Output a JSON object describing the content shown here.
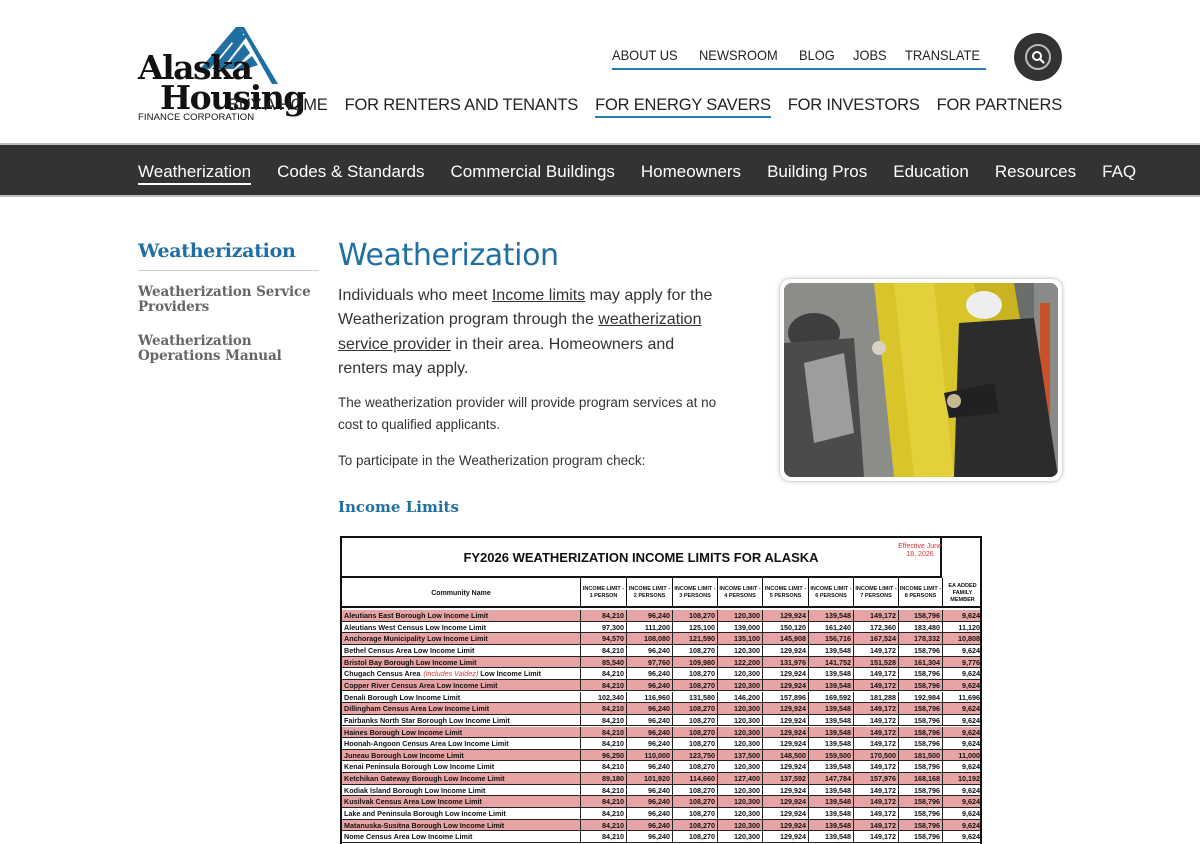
{
  "brand": {
    "line1": "Alaska",
    "line2": "Housing",
    "line3": "FINANCE CORPORATION",
    "colors": {
      "blue": "#1f6fa3",
      "nav_dark": "#333333"
    }
  },
  "utility_nav": [
    "ABOUT US",
    "NEWSROOM",
    "BLOG",
    "JOBS",
    "TRANSLATE"
  ],
  "search_icon": "search-icon",
  "main_nav": [
    {
      "label": "BUY A HOME",
      "active": false
    },
    {
      "label": "FOR RENTERS AND TENANTS",
      "active": false
    },
    {
      "label": "FOR ENERGY SAVERS",
      "active": true
    },
    {
      "label": "FOR INVESTORS",
      "active": false
    },
    {
      "label": "FOR PARTNERS",
      "active": false
    }
  ],
  "sub_nav": [
    {
      "label": "Weatherization",
      "active": true
    },
    {
      "label": "Codes & Standards",
      "active": false
    },
    {
      "label": "Commercial Buildings",
      "active": false
    },
    {
      "label": "Homeowners",
      "active": false
    },
    {
      "label": "Building Pros",
      "active": false
    },
    {
      "label": "Education",
      "active": false
    },
    {
      "label": "Resources",
      "active": false
    },
    {
      "label": "FAQ",
      "active": false
    }
  ],
  "sidebar": {
    "title": "Weatherization",
    "items": [
      {
        "line1": "Weatherization Service",
        "line2": "Providers"
      },
      {
        "line1": "Weatherization",
        "line2": "Operations Manual"
      }
    ]
  },
  "main": {
    "title": "Weatherization",
    "lead": {
      "t1": "Individuals who meet ",
      "link1": "Income limits",
      "t2": " may apply for the Weatherization program through the ",
      "link2": "weatherization service provider",
      "t3": " in their area. Homeowners and renters may apply."
    },
    "p2": "The weatherization provider will provide program services at no cost to qualified applicants.",
    "p3": "To participate in the Weatherization program check:",
    "section_heading": "Income Limits"
  },
  "income_table": {
    "title": "FY2026 WEATHERIZATION INCOME LIMITS FOR ALASKA",
    "effective": "Effective June 18, 2026",
    "headers": [
      "Community Name",
      "INCOME LIMIT - 1 PERSON",
      "INCOME LIMIT - 2 PERSONS",
      "INCOME LIMIT - 3 PERSONS",
      "INCOME LIMIT - 4 PERSONS",
      "INCOME LIMIT - 5 PERSONS",
      "INCOME LIMIT - 6 PERSONS",
      "INCOME LIMIT - 7 PERSONS",
      "INCOME LIMIT - 8 PERSONS",
      "EA ADDED FAMILY MEMBER"
    ],
    "rows": [
      {
        "name": "Aleutians East Borough Low Income Limit",
        "v": [
          "84,210",
          "96,240",
          "108,270",
          "120,300",
          "129,924",
          "139,548",
          "149,172",
          "158,796",
          "9,624"
        ],
        "pink": true
      },
      {
        "name": "Aleutians West Census Low Income Limit",
        "v": [
          "97,300",
          "111,200",
          "125,100",
          "139,000",
          "150,120",
          "161,240",
          "172,360",
          "183,480",
          "11,120"
        ],
        "pink": false
      },
      {
        "name": "Anchorage Municipality Low Income Limit",
        "v": [
          "94,570",
          "108,080",
          "121,590",
          "135,100",
          "145,908",
          "156,716",
          "167,524",
          "178,332",
          "10,808"
        ],
        "pink": true
      },
      {
        "name": "Bethel Census Area Low Income Limit",
        "v": [
          "84,210",
          "96,240",
          "108,270",
          "120,300",
          "129,924",
          "139,548",
          "149,172",
          "158,796",
          "9,624"
        ],
        "pink": false
      },
      {
        "name": "Bristol Bay Borough Low Income Limit",
        "v": [
          "85,540",
          "97,760",
          "109,980",
          "122,200",
          "131,976",
          "141,752",
          "151,528",
          "161,304",
          "9,776"
        ],
        "pink": true
      },
      {
        "name": "Chugach Census Area",
        "vald": "(includes Valdez)",
        "name2": " Low Income Limit",
        "v": [
          "84,210",
          "96,240",
          "108,270",
          "120,300",
          "129,924",
          "139,548",
          "149,172",
          "158,796",
          "9,624"
        ],
        "pink": false
      },
      {
        "name": "Copper River Census Area Low Income Limit",
        "v": [
          "84,210",
          "96,240",
          "108,270",
          "120,300",
          "129,924",
          "139,548",
          "149,172",
          "158,796",
          "9,624"
        ],
        "pink": true
      },
      {
        "name": "Denali Borough Low Income Limit",
        "v": [
          "102,340",
          "116,960",
          "131,580",
          "146,200",
          "157,896",
          "169,592",
          "181,288",
          "192,984",
          "11,696"
        ],
        "pink": false
      },
      {
        "name": "Dillingham Census Area Low Income Limit",
        "v": [
          "84,210",
          "96,240",
          "108,270",
          "120,300",
          "129,924",
          "139,548",
          "149,172",
          "158,796",
          "9,624"
        ],
        "pink": true
      },
      {
        "name": "Fairbanks North Star Borough Low Income Limit",
        "v": [
          "84,210",
          "96,240",
          "108,270",
          "120,300",
          "129,924",
          "139,548",
          "149,172",
          "158,796",
          "9,624"
        ],
        "pink": false
      },
      {
        "name": "Haines Borough Low  Income Limit",
        "v": [
          "84,210",
          "96,240",
          "108,270",
          "120,300",
          "129,924",
          "139,548",
          "149,172",
          "158,796",
          "9,624"
        ],
        "pink": true
      },
      {
        "name": "Hoonah-Angoon Census Area Low Income Limit",
        "v": [
          "84,210",
          "96,240",
          "108,270",
          "120,300",
          "129,924",
          "139,548",
          "149,172",
          "158,796",
          "9,624"
        ],
        "pink": false
      },
      {
        "name": "Juneau Borough Low Income Limit",
        "v": [
          "96,250",
          "110,000",
          "123,750",
          "137,500",
          "148,500",
          "159,500",
          "170,500",
          "181,500",
          "11,000"
        ],
        "pink": true
      },
      {
        "name": "Kenai Peninsula Borough Low Income Limit",
        "v": [
          "84,210",
          "96,240",
          "108,270",
          "120,300",
          "129,924",
          "139,548",
          "149,172",
          "158,796",
          "9,624"
        ],
        "pink": false
      },
      {
        "name": "Ketchikan Gateway Borough Low Income Limit",
        "v": [
          "89,180",
          "101,920",
          "114,660",
          "127,400",
          "137,592",
          "147,784",
          "157,976",
          "168,168",
          "10,192"
        ],
        "pink": true
      },
      {
        "name": "Kodiak Island Borough Low Income Limit",
        "v": [
          "84,210",
          "96,240",
          "108,270",
          "120,300",
          "129,924",
          "139,548",
          "149,172",
          "158,796",
          "9,624"
        ],
        "pink": false
      },
      {
        "name": "Kusilvak Census Area Low Income Limit",
        "v": [
          "84,210",
          "96,240",
          "108,270",
          "120,300",
          "129,924",
          "139,548",
          "149,172",
          "158,796",
          "9,624"
        ],
        "pink": true
      },
      {
        "name": "Lake and Peninsula Borough Low Income Limit",
        "v": [
          "84,210",
          "96,240",
          "108,270",
          "120,300",
          "129,924",
          "139,548",
          "149,172",
          "158,796",
          "9,624"
        ],
        "pink": false
      },
      {
        "name": "Matanuska-Susitna Borough Low Income Limit",
        "v": [
          "84,210",
          "96,240",
          "108,270",
          "120,300",
          "129,924",
          "139,548",
          "149,172",
          "158,796",
          "9,624"
        ],
        "pink": true
      },
      {
        "name": "Nome Census Area Low Income Limit",
        "v": [
          "84,210",
          "96,240",
          "108,270",
          "120,300",
          "129,924",
          "139,548",
          "149,172",
          "158,796",
          "9,624"
        ],
        "pink": false
      }
    ]
  }
}
